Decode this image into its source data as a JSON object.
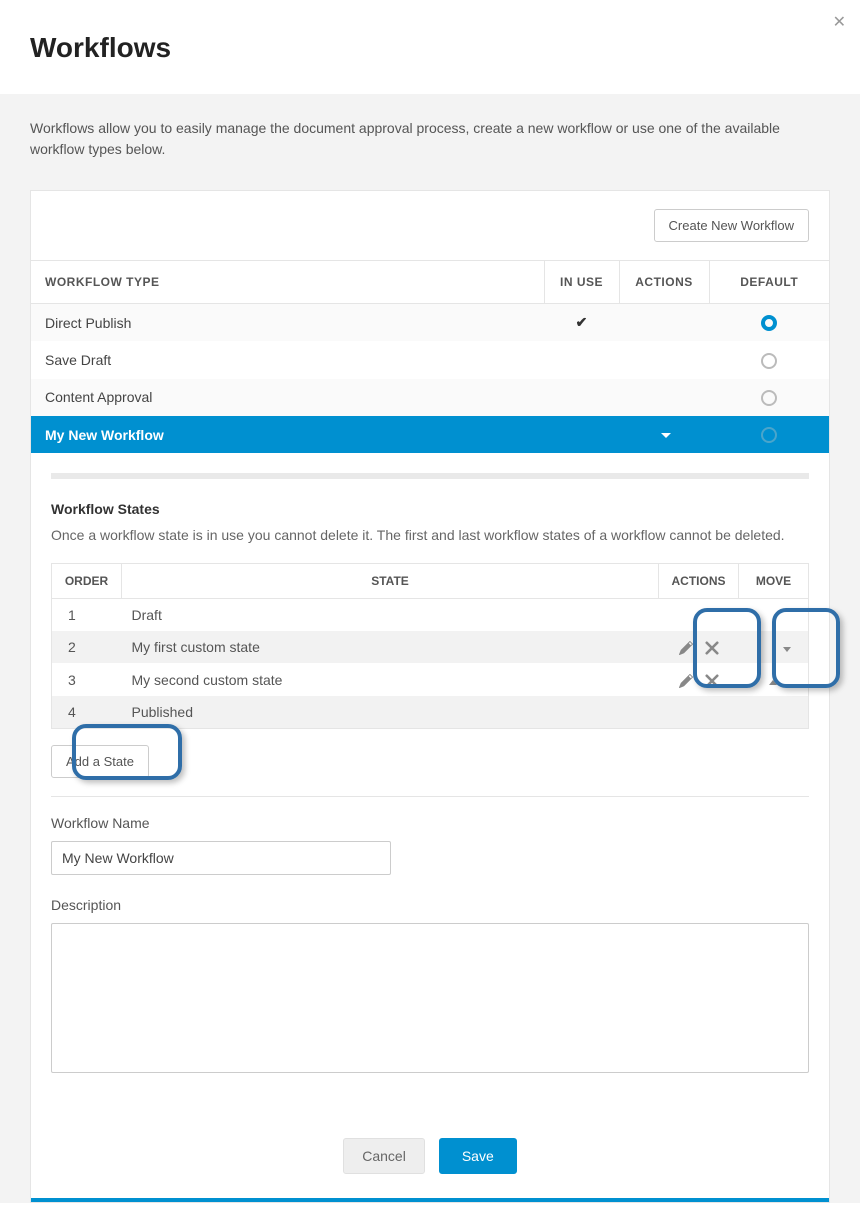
{
  "page_title": "Workflows",
  "intro": "Workflows allow you to easily manage the document approval process, create a new workflow or use one of the available workflow types below.",
  "create_button": "Create New Workflow",
  "columns": {
    "type": "WORKFLOW TYPE",
    "inuse": "IN USE",
    "actions": "ACTIONS",
    "default": "DEFAULT"
  },
  "workflows": [
    {
      "name": "Direct Publish",
      "in_use": true,
      "default_selected": true
    },
    {
      "name": "Save Draft",
      "in_use": false,
      "default_selected": false
    },
    {
      "name": "Content Approval",
      "in_use": false,
      "default_selected": false
    },
    {
      "name": "My New Workflow",
      "in_use": false,
      "default_selected": false,
      "active": true
    }
  ],
  "states_section": {
    "title": "Workflow States",
    "desc": "Once a workflow state is in use you cannot delete it. The first and last workflow states of a workflow cannot be deleted."
  },
  "state_columns": {
    "order": "ORDER",
    "state": "STATE",
    "actions": "ACTIONS",
    "move": "MOVE"
  },
  "states": [
    {
      "order": "1",
      "name": "Draft",
      "editable": false,
      "move_up": false,
      "move_down": false
    },
    {
      "order": "2",
      "name": "My first custom state",
      "editable": true,
      "move_up": false,
      "move_down": true
    },
    {
      "order": "3",
      "name": "My second custom state",
      "editable": true,
      "move_up": true,
      "move_down": false
    },
    {
      "order": "4",
      "name": "Published",
      "editable": false,
      "move_up": false,
      "move_down": false
    }
  ],
  "add_state_label": "Add a State",
  "form": {
    "name_label": "Workflow Name",
    "name_value": "My New Workflow",
    "desc_label": "Description",
    "desc_value": ""
  },
  "buttons": {
    "cancel": "Cancel",
    "save": "Save"
  }
}
